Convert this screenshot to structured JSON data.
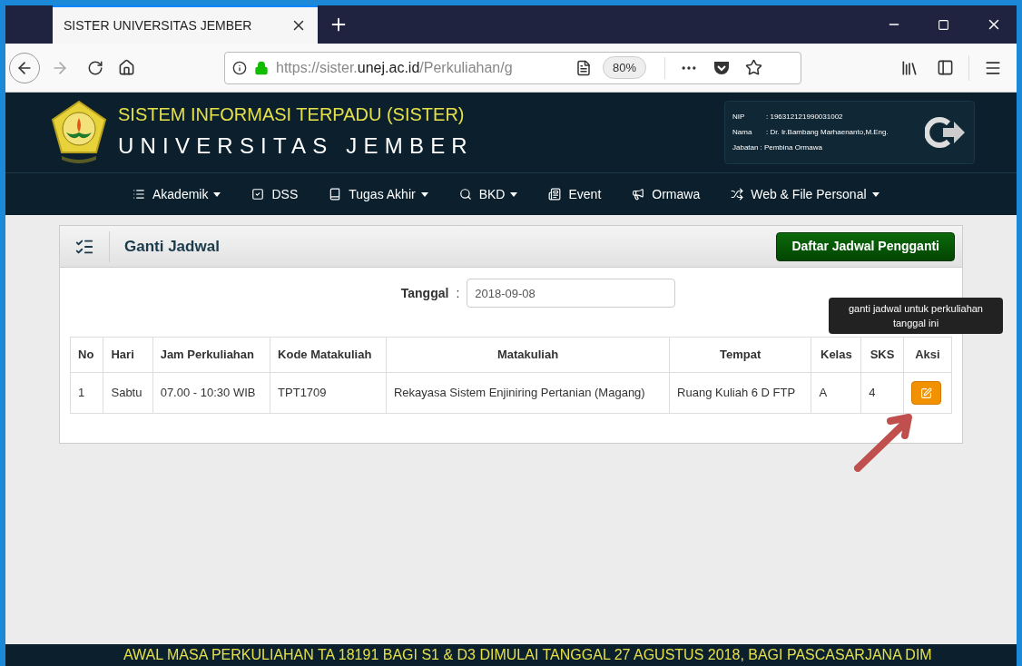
{
  "browser": {
    "tab_title": "SISTER UNIVERSITAS JEMBER",
    "url": {
      "prefix": "https://sister.",
      "host": "unej.ac.id",
      "path": "/Perkuliahan/g"
    },
    "zoom": "80%"
  },
  "header": {
    "title": "SISTEM INFORMASI TERPADU (SISTER)",
    "subtitle": "UNIVERSITAS JEMBER",
    "user": [
      {
        "label": "NIP",
        "value": ": 196312121990031002"
      },
      {
        "label": "Nama",
        "value": ": Dr. Ir.Bambang Marhaenanto,M.Eng."
      },
      {
        "label": "Jabatan",
        "value": ": Pembina Ormawa"
      }
    ]
  },
  "nav": [
    {
      "label": "Akademik",
      "dropdown": true
    },
    {
      "label": "DSS",
      "dropdown": false
    },
    {
      "label": "Tugas Akhir",
      "dropdown": true
    },
    {
      "label": "BKD",
      "dropdown": true
    },
    {
      "label": "Event",
      "dropdown": false
    },
    {
      "label": "Ormawa",
      "dropdown": false
    },
    {
      "label": "Web & File Personal",
      "dropdown": true
    }
  ],
  "panel": {
    "title": "Ganti Jadwal",
    "button": "Daftar Jadwal Pengganti",
    "date_label": "Tanggal",
    "date_separator": ":",
    "date_value": "2018-09-08",
    "table": {
      "columns": [
        "No",
        "Hari",
        "Jam Perkuliahan",
        "Kode Matakuliah",
        "Matakuliah",
        "Tempat",
        "Kelas",
        "SKS",
        "Aksi"
      ],
      "rows": [
        {
          "cells": [
            "1",
            "Sabtu",
            "07.00 - 10:30 WIB",
            "TPT1709",
            "Rekayasa Sistem Enjiniring Pertanian (Magang)",
            "Ruang Kuliah 6 D FTP",
            "A",
            "4"
          ]
        }
      ]
    },
    "tooltip": "ganti jadwal untuk perkuliahan tanggal ini"
  },
  "ticker": "AWAL MASA PERKULIAHAN TA 18191 BAGI S1 & D3 DIMULAI TANGGAL 27 AGUSTUS 2018, BAGI PASCASARJANA DIM"
}
